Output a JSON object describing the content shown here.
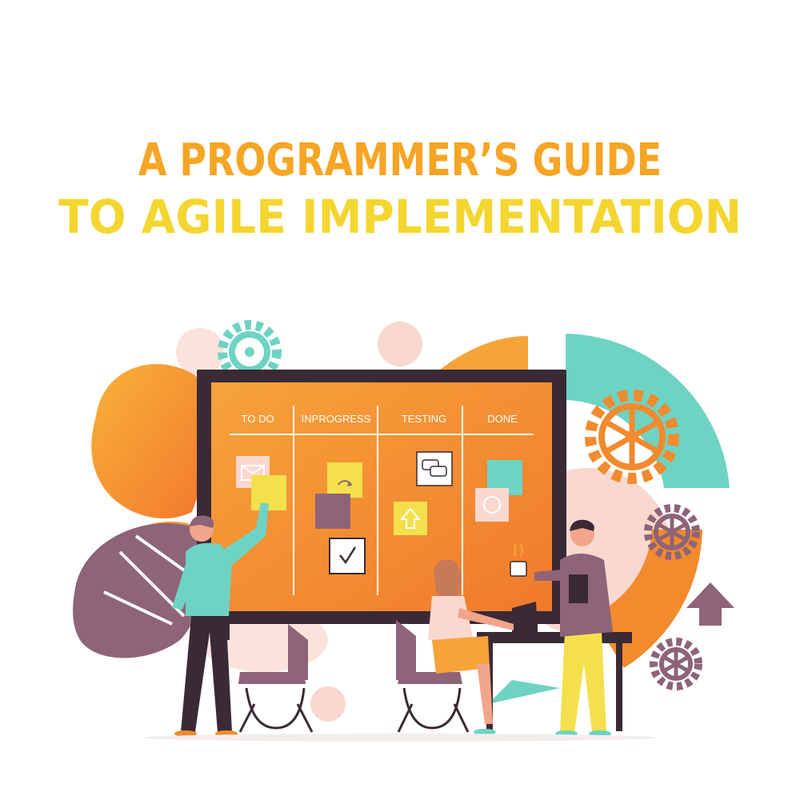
{
  "title": {
    "line1": "A PROGRAMMER’S GUIDE",
    "line2": "TO AGILE IMPLEMENTATION"
  },
  "board": {
    "columns": [
      "TO DO",
      "INPROGRESS",
      "TESTING",
      "DONE"
    ]
  },
  "colors": {
    "title_orange": "#F6A524",
    "title_yellow": "#F4D630",
    "board_orange": "#F28A2E",
    "board_frame": "#3A2A35",
    "teal": "#6ED3C3",
    "plum": "#8E6478",
    "sticky_yellow": "#F4E04D",
    "blush": "#F9D8CF"
  },
  "icons": [
    "gear-icon",
    "mail-icon",
    "arrow-circle-icon",
    "chat-icon",
    "arrow-up-icon",
    "checkmark-icon",
    "target-icon",
    "coffee-cup-icon",
    "tablet-icon"
  ]
}
